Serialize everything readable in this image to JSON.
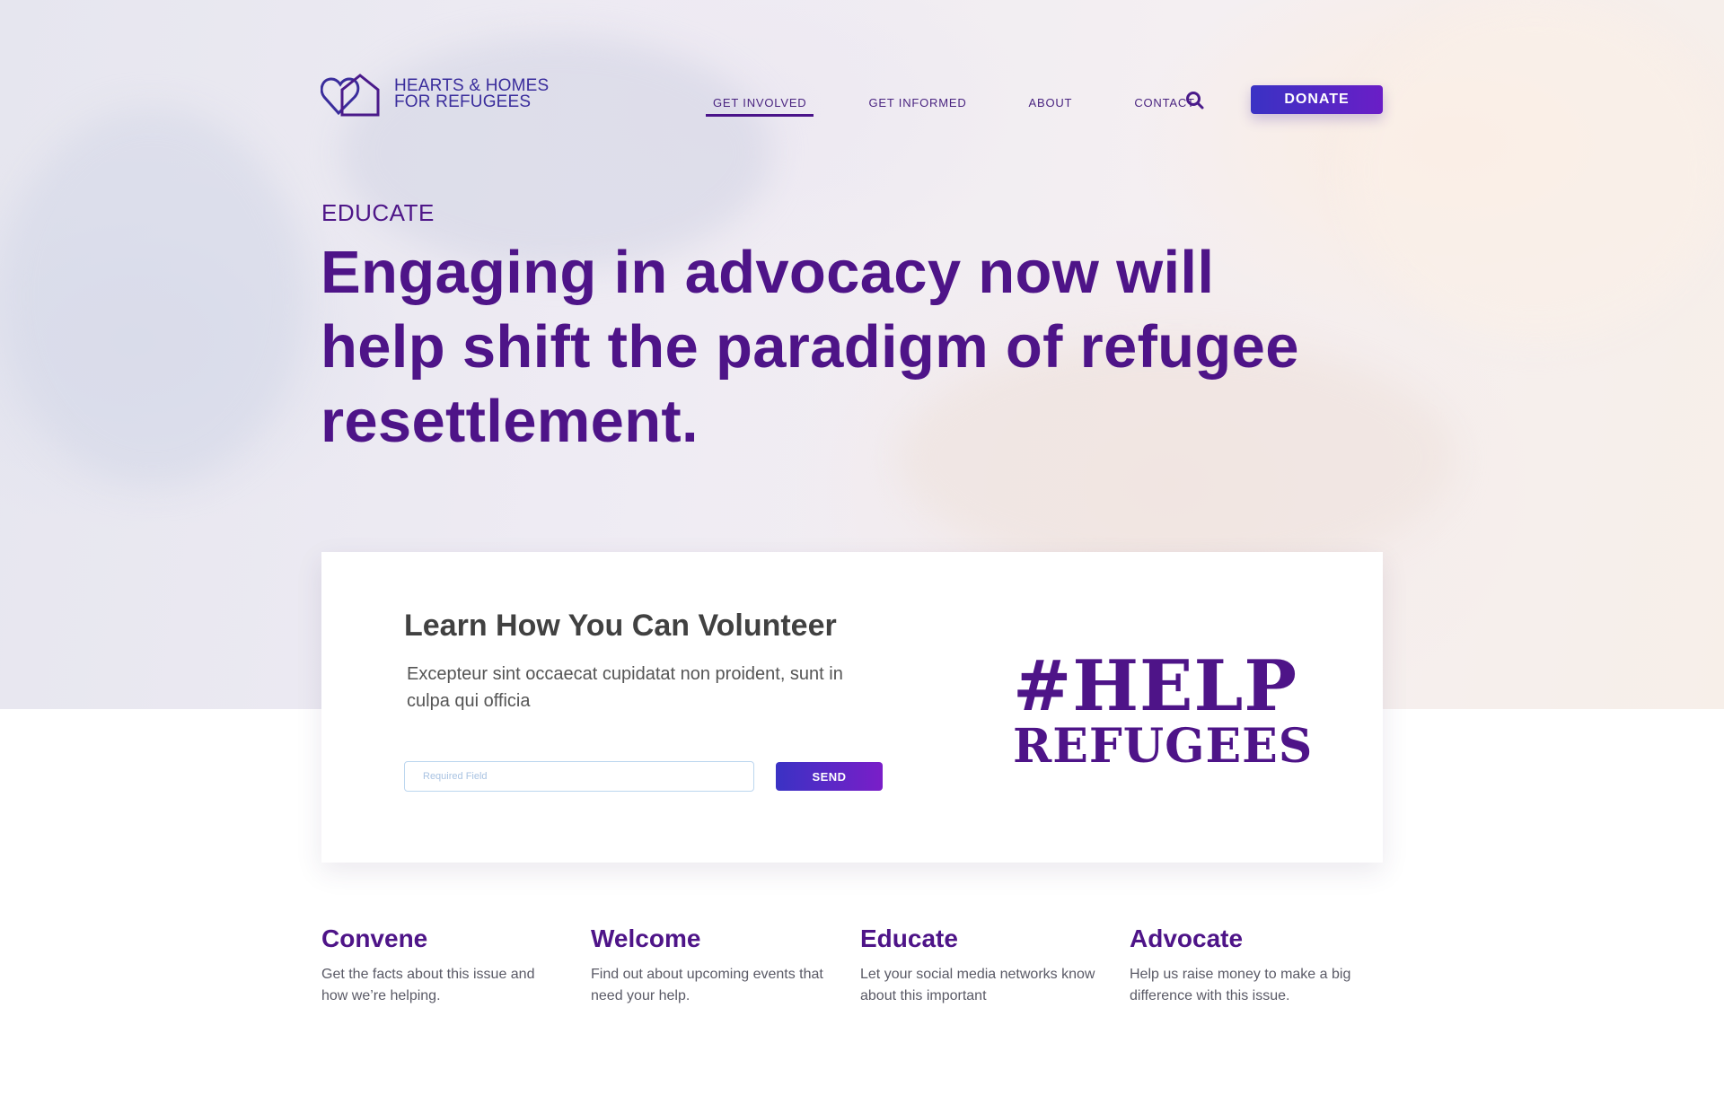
{
  "brand": {
    "line1": "HEARTS & HOMES",
    "line2": "FOR REFUGEES"
  },
  "nav": {
    "items": [
      {
        "label": "GET INVOLVED",
        "active": true
      },
      {
        "label": "GET INFORMED",
        "active": false
      },
      {
        "label": "ABOUT",
        "active": false
      },
      {
        "label": "CONTACT",
        "active": false
      }
    ],
    "search_icon": "search-icon",
    "donate_label": "DONATE"
  },
  "hero": {
    "eyebrow": "EDUCATE",
    "headline": "Engaging in advocacy now will help shift the paradigm of refugee resettlement."
  },
  "volunteer": {
    "title": "Learn How You Can Volunteer",
    "subtitle": "Excepteur sint occaecat cupidatat non proident, sunt in culpa qui officia",
    "input_placeholder": "Required Field",
    "input_value": "",
    "send_label": "SEND",
    "hashtag_line1": "#HELP",
    "hashtag_line2": "REFUGEES"
  },
  "features": [
    {
      "title": "Convene",
      "text": "Get the facts about this issue and how we’re helping."
    },
    {
      "title": "Welcome",
      "text": "Find out about upcoming events that need your help."
    },
    {
      "title": "Educate",
      "text": "Let your social media networks know about this important"
    },
    {
      "title": "Advocate",
      "text": "Help us raise money to make a big difference with this issue."
    }
  ],
  "colors": {
    "primary": "#4e1488",
    "accent_start": "#3a32c4",
    "accent_end": "#6a1ec6",
    "logo": "#3a2d9c"
  }
}
